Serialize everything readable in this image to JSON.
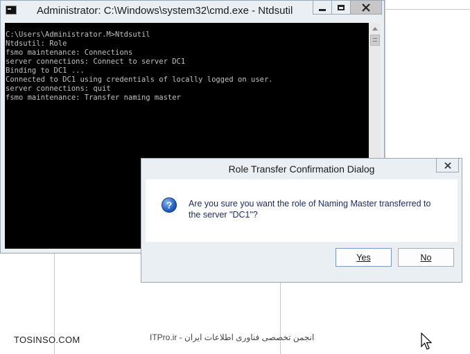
{
  "cmd_window": {
    "title": "Administrator: C:\\Windows\\system32\\cmd.exe - Ntdsutil",
    "console_lines": [
      "C:\\Users\\Administrator.M>Ntdsutil",
      "Ntdsutil: Role",
      "fsmo maintenance: Connections",
      "server connections: Connect to server DC1",
      "Binding to DC1 ...",
      "Connected to DC1 using credentials of locally logged on user.",
      "server connections: quit",
      "fsmo maintenance: Transfer naming master"
    ]
  },
  "dialog": {
    "title": "Role Transfer Confirmation Dialog",
    "message": "Are you sure you want the role of Naming Master transferred to the server \"DC1\"?",
    "icon": "question-icon",
    "yes_label": "Yes",
    "no_label": "No"
  },
  "watermark": {
    "left": "TOSINSO.COM",
    "center": "ITPro.ir - انجمن تخصصی فناوری اطلاعات ایران"
  },
  "colors": {
    "console_bg": "#000000",
    "console_text": "#c0c0c0",
    "window_frame": "#e9eff3",
    "message_text": "#1e2a6b"
  }
}
